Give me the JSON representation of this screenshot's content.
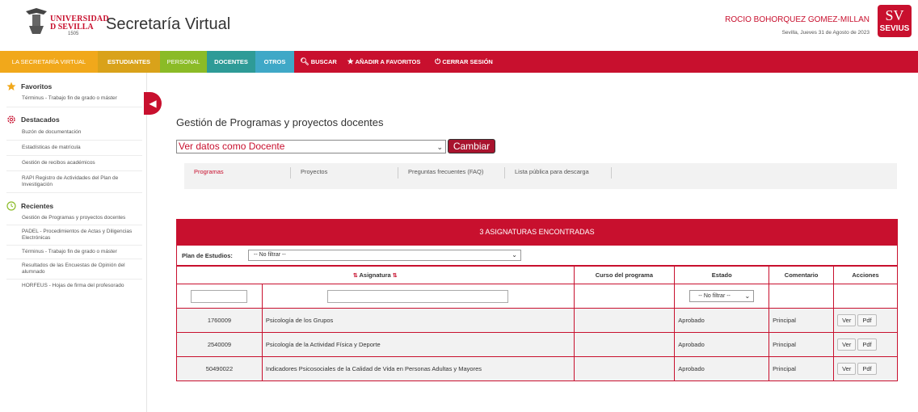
{
  "header": {
    "logo_line1": "UNIVERSIDAD",
    "logo_line2": "D SEVILLA",
    "logo_year": "1505",
    "app_title": "Secretaría Virtual",
    "user_name": "ROCIO BOHORQUEZ GOMEZ-MILLAN",
    "date_text": "Sevilla, Jueves 31 de Agosto de 2023",
    "badge_glyph": "SV",
    "badge_text": "SEVIUS"
  },
  "nav": {
    "items": [
      {
        "label": "LA SECRETARÍA VIRTUAL"
      },
      {
        "label": "ESTUDIANTES"
      },
      {
        "label": "PERSONAL"
      },
      {
        "label": "DOCENTES"
      },
      {
        "label": "OTROS"
      },
      {
        "label": "BUSCAR"
      },
      {
        "label": "AÑADIR A FAVORITOS"
      },
      {
        "label": "CERRAR SESIÓN"
      }
    ]
  },
  "sidebar": {
    "favoritos": {
      "title": "Favoritos",
      "items": [
        "Términus - Trabajo fin de grado o máster"
      ]
    },
    "destacados": {
      "title": "Destacados",
      "items": [
        "Buzón de documentación",
        "Estadísticas de matrícula",
        "Gestión de recibos académicos",
        "RAPI Registro de Actividades del Plan de Investigación"
      ]
    },
    "recientes": {
      "title": "Recientes",
      "items": [
        "Gestión de Programas y proyectos docentes",
        "PADEL - Procedimientos de Actas y Diligencias Electrónicas",
        "Términus - Trabajo fin de grado o máster",
        "Resultados de las Encuestas de Opinión del alumnado",
        "HORFEUS - Hojas de firma del profesorado"
      ]
    }
  },
  "main": {
    "title": "Gestión de Programas y proyectos docentes",
    "view_select": "Ver datos como Docente",
    "change_button": "Cambiar",
    "tabs": [
      {
        "label": "Programas"
      },
      {
        "label": "Proyectos"
      },
      {
        "label": "Preguntas frecuentes (FAQ)"
      },
      {
        "label": "Lista pública para descarga"
      }
    ]
  },
  "table": {
    "caption": "3 ASIGNATURAS ENCONTRADAS",
    "plan_label": "Plan de Estudios:",
    "plan_value": "-- No filtrar --",
    "columns": {
      "asignatura": "Asignatura",
      "curso": "Curso del programa",
      "estado": "Estado",
      "comentario": "Comentario",
      "acciones": "Acciones"
    },
    "estado_filter": "-- No filtrar --",
    "action_ver": "Ver",
    "action_pdf": "Pdf",
    "rows": [
      {
        "code": "1760009",
        "name": "Psicología de los Grupos",
        "curso": "",
        "estado": "Aprobado",
        "comentario": "Principal"
      },
      {
        "code": "2540009",
        "name": "Psicología de la Actividad Física y Deporte",
        "curso": "",
        "estado": "Aprobado",
        "comentario": "Principal"
      },
      {
        "code": "50490022",
        "name": "Indicadores Psicosociales de la Calidad de Vida en Personas Adultas y Mayores",
        "curso": "",
        "estado": "Aprobado",
        "comentario": "Principal"
      }
    ]
  },
  "colors": {
    "brand_red": "#c8102e",
    "nav_yellow": "#f1a81b",
    "nav_green": "#8bbb27",
    "nav_teal": "#2e9b97",
    "nav_blue": "#3fa8c7"
  },
  "icons": {
    "favoritos": "star-icon",
    "destacados": "gear-icon",
    "recientes": "clock-icon",
    "buscar": "search-icon",
    "favoritos_nav": "star-icon",
    "cerrar": "power-icon",
    "toggle": "chevron-left-icon"
  }
}
